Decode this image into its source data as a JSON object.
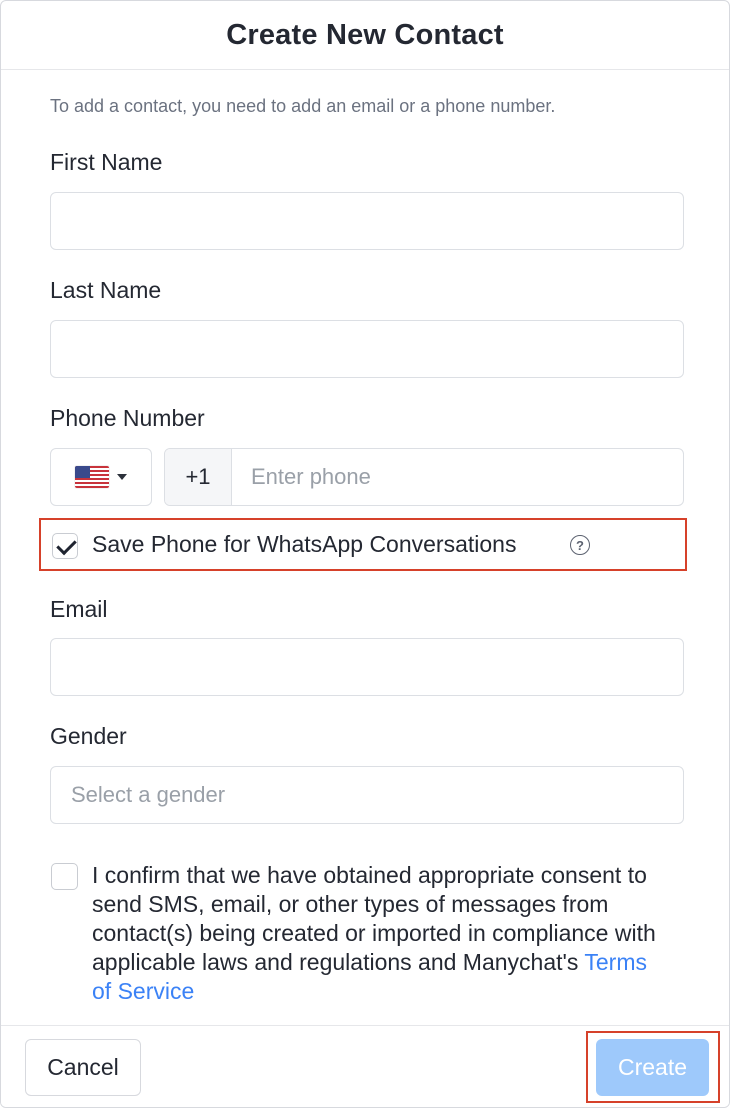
{
  "dialog": {
    "title": "Create New Contact",
    "hint": "To add a contact, you need to add an email or a phone number."
  },
  "fields": {
    "first_name": {
      "label": "First Name",
      "value": "",
      "placeholder": ""
    },
    "last_name": {
      "label": "Last Name",
      "value": "",
      "placeholder": ""
    },
    "phone": {
      "label": "Phone Number",
      "country_flag_icon": "us-flag-icon",
      "country_code": "+1",
      "value": "",
      "placeholder": "Enter phone"
    },
    "whatsapp": {
      "label": "Save Phone for WhatsApp Conversations",
      "checked": true,
      "help_icon": "question-circle-icon"
    },
    "email": {
      "label": "Email",
      "value": "",
      "placeholder": ""
    },
    "gender": {
      "label": "Gender",
      "placeholder": "Select a gender"
    }
  },
  "consent": {
    "checked": false,
    "text": "I confirm that we have obtained appropriate consent to send SMS, email, or other types of messages from contact(s) being created or imported in compliance with applicable laws and regulations and Manychat's ",
    "link_text": "Terms of Service"
  },
  "footer": {
    "cancel_label": "Cancel",
    "create_label": "Create"
  },
  "colors": {
    "accent_link": "#3b82f6",
    "create_button_disabled": "#9ec9fb",
    "highlight_outline": "#d6412a"
  }
}
